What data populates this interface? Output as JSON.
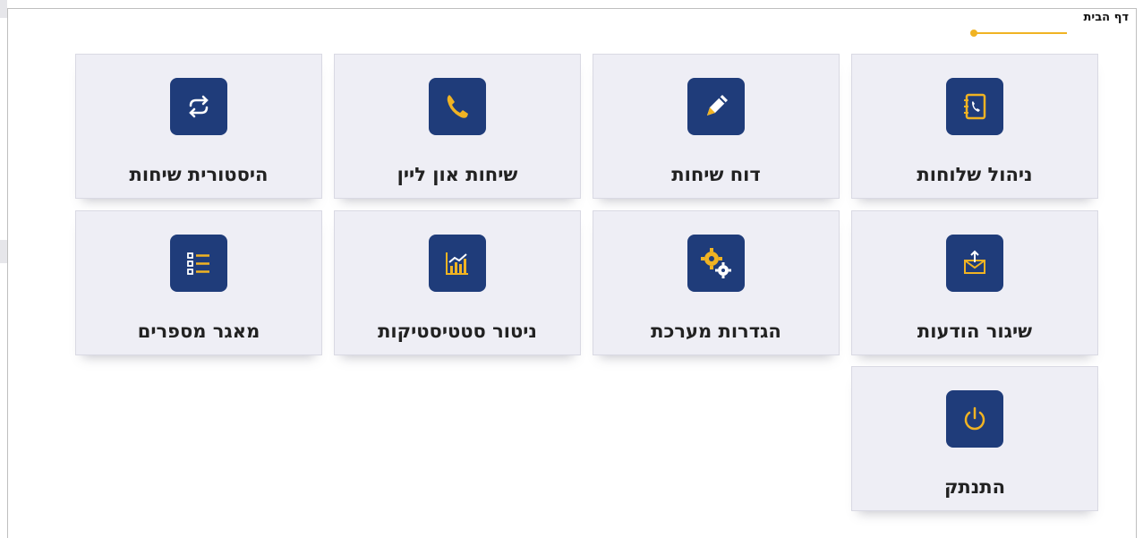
{
  "breadcrumb": {
    "label": "דף הבית"
  },
  "colors": {
    "icon_bg": "#1f3c7a",
    "accent": "#f0b323",
    "tile_bg": "#eeeef5"
  },
  "tiles": [
    {
      "label": "ניהול שלוחות",
      "icon": "contacts-book-icon"
    },
    {
      "label": "דוח שיחות",
      "icon": "pencil-icon"
    },
    {
      "label": "שיחות און ליין",
      "icon": "phone-icon"
    },
    {
      "label": "היסטורית שיחות",
      "icon": "repeat-icon"
    },
    {
      "label": "שיגור הודעות",
      "icon": "send-mail-icon"
    },
    {
      "label": "הגדרות מערכת",
      "icon": "gears-icon"
    },
    {
      "label": "ניטור סטטיסטיקות",
      "icon": "stats-chart-icon"
    },
    {
      "label": "מאגר מספרים",
      "icon": "list-icon"
    },
    {
      "label": "התנתק",
      "icon": "power-icon"
    }
  ]
}
